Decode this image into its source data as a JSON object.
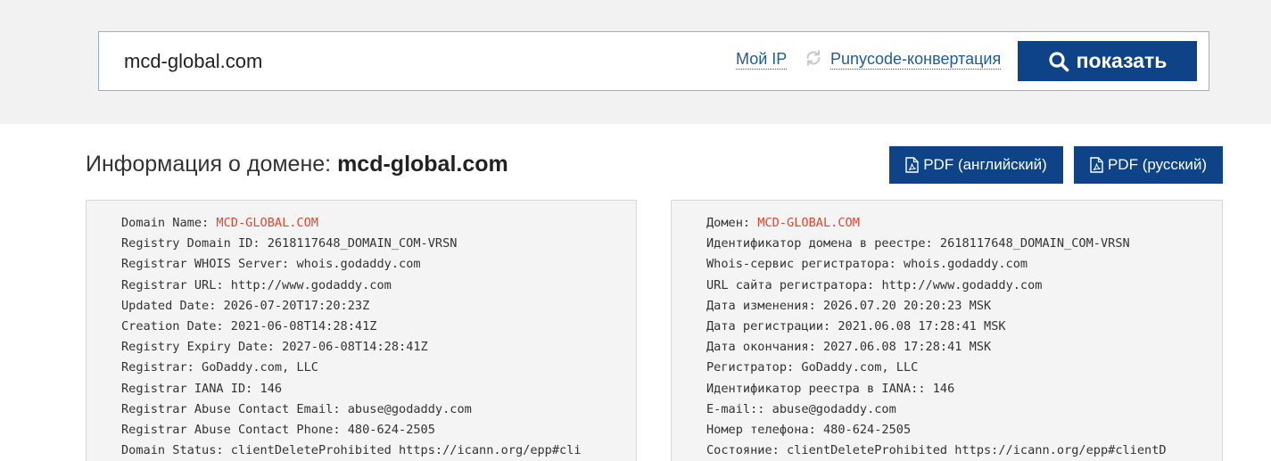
{
  "search": {
    "value": "mcd-global.com",
    "my_ip_label": "Мой IP",
    "punycode_label": "Punycode-конвертация",
    "button_label": "показать"
  },
  "domain_info": {
    "title_prefix": "Информация о домене:",
    "domain": "mcd-global.com",
    "pdf_en_label": "PDF (английский)",
    "pdf_ru_label": "PDF (русский)"
  },
  "whois_en": [
    {
      "key": "Domain Name:",
      "value": "MCD-GLOBAL.COM",
      "highlight": true
    },
    {
      "key": "Registry Domain ID:",
      "value": "2618117648_DOMAIN_COM-VRSN"
    },
    {
      "key": "Registrar WHOIS Server:",
      "value": "whois.godaddy.com"
    },
    {
      "key": "Registrar URL:",
      "value": "http://www.godaddy.com"
    },
    {
      "key": "Updated Date:",
      "value": "2026-07-20T17:20:23Z"
    },
    {
      "key": "Creation Date:",
      "value": "2021-06-08T14:28:41Z"
    },
    {
      "key": "Registry Expiry Date:",
      "value": "2027-06-08T14:28:41Z"
    },
    {
      "key": "Registrar:",
      "value": "GoDaddy.com, LLC"
    },
    {
      "key": "Registrar IANA ID:",
      "value": "146"
    },
    {
      "key": "Registrar Abuse Contact Email:",
      "value": "abuse@godaddy.com"
    },
    {
      "key": "Registrar Abuse Contact Phone:",
      "value": "480-624-2505"
    },
    {
      "key": "Domain Status:",
      "value": "clientDeleteProhibited https://icann.org/epp#cli"
    }
  ],
  "whois_ru": [
    {
      "key": "Домен:",
      "value": "MCD-GLOBAL.COM",
      "highlight": true
    },
    {
      "key": "Идентификатор домена в реестре:",
      "value": "2618117648_DOMAIN_COM-VRSN"
    },
    {
      "key": "Whois-сервис регистратора:",
      "value": "whois.godaddy.com"
    },
    {
      "key": "URL сайта регистратора:",
      "value": "http://www.godaddy.com"
    },
    {
      "key": "Дата изменения:",
      "value": "2026.07.20 20:20:23 MSK"
    },
    {
      "key": "Дата регистрации:",
      "value": "2021.06.08 17:28:41 MSK"
    },
    {
      "key": "Дата окончания:",
      "value": "2027.06.08 17:28:41 MSK"
    },
    {
      "key": "Регистратор:",
      "value": "GoDaddy.com, LLC"
    },
    {
      "key": "Идентификатор реестра в IANA::",
      "value": "146"
    },
    {
      "key": "E-mail::",
      "value": "abuse@godaddy.com"
    },
    {
      "key": "Номер телефона:",
      "value": "480-624-2505"
    },
    {
      "key": "Состояние:",
      "value": "clientDeleteProhibited https://icann.org/epp#clientD"
    }
  ],
  "colors": {
    "primary": "#0e4487",
    "link": "#1f5c99",
    "highlight": "#e0462c",
    "panel_bg": "#f4f4f4"
  }
}
